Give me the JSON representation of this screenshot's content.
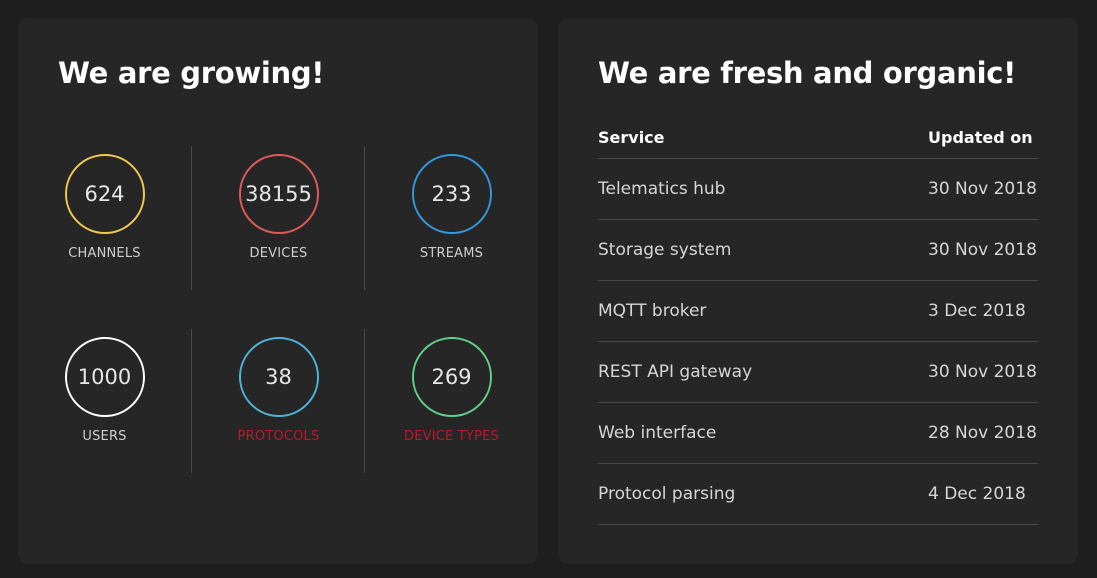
{
  "growing": {
    "title": "We are growing!",
    "stats": [
      {
        "value": "624",
        "label": "CHANNELS",
        "color": "#f2c94c",
        "highlight": false
      },
      {
        "value": "38155",
        "label": "DEVICES",
        "color": "#e05a5a",
        "highlight": false
      },
      {
        "value": "233",
        "label": "STREAMS",
        "color": "#3498db",
        "highlight": false
      },
      {
        "value": "1000",
        "label": "USERS",
        "color": "#ffffff",
        "highlight": false
      },
      {
        "value": "38",
        "label": "PROTOCOLS",
        "color": "#4fb3d9",
        "highlight": true
      },
      {
        "value": "269",
        "label": "DEVICE TYPES",
        "color": "#5fcf8c",
        "highlight": true
      }
    ]
  },
  "fresh": {
    "title": "We are fresh and organic!",
    "headers": {
      "service": "Service",
      "updated": "Updated on"
    },
    "rows": [
      {
        "service": "Telematics hub",
        "updated": "30 Nov 2018"
      },
      {
        "service": "Storage system",
        "updated": "30 Nov 2018"
      },
      {
        "service": "MQTT broker",
        "updated": "3 Dec 2018"
      },
      {
        "service": "REST API gateway",
        "updated": "30 Nov 2018"
      },
      {
        "service": "Web interface",
        "updated": "28 Nov 2018"
      },
      {
        "service": "Protocol parsing",
        "updated": "4 Dec 2018"
      }
    ]
  },
  "colors": {
    "background": "#1e1e1e",
    "card": "#262626",
    "divider": "#4a4a4a",
    "link": "#c0172c"
  }
}
